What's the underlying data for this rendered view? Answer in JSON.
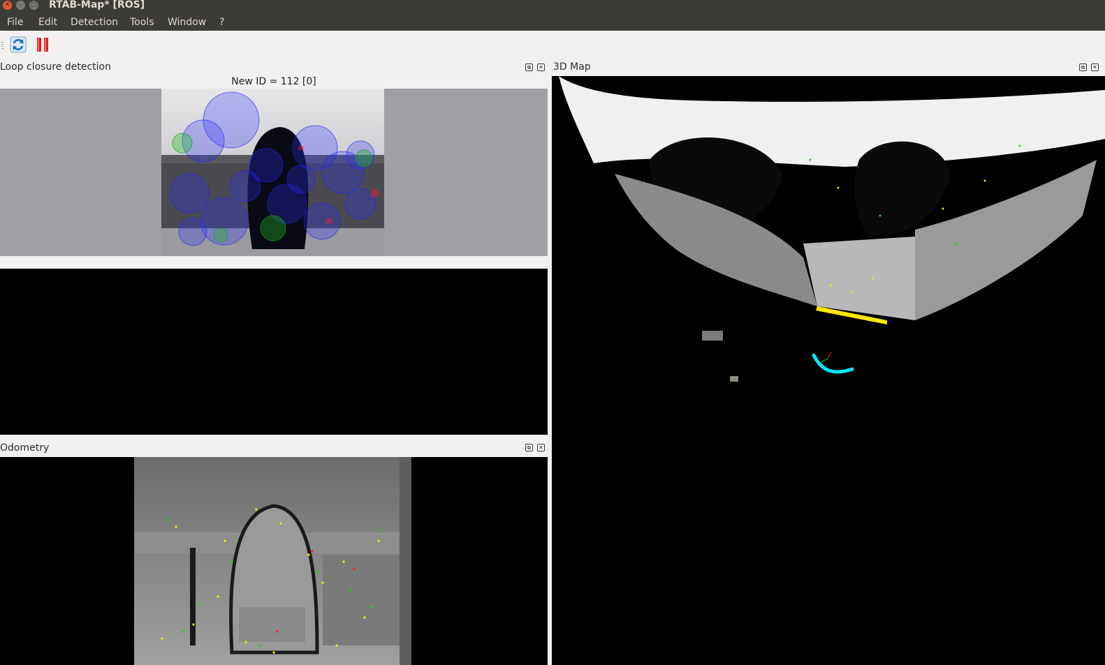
{
  "window": {
    "title": "RTAB-Map* [ROS]"
  },
  "menu": {
    "items": [
      "File",
      "Edit",
      "Detection",
      "Tools",
      "Window",
      "?"
    ]
  },
  "toolbar": {
    "buttons": [
      "refresh-icon",
      "pause-icon"
    ]
  },
  "docks": {
    "loop_closure": {
      "title": "Loop closure detection",
      "new_id_label": "New ID = 112 [0]"
    },
    "odometry": {
      "title": "Odometry"
    },
    "map3d": {
      "title": "3D Map"
    }
  },
  "colors": {
    "titlebar": "#3c3b37",
    "panel": "#f2f1f0",
    "loop_view_bg": "#a0a0a4",
    "feature_blue": "#2a2aff",
    "feature_green": "#18c018",
    "trajectory": "#00e5ff",
    "floor_features": "#ffe600"
  }
}
